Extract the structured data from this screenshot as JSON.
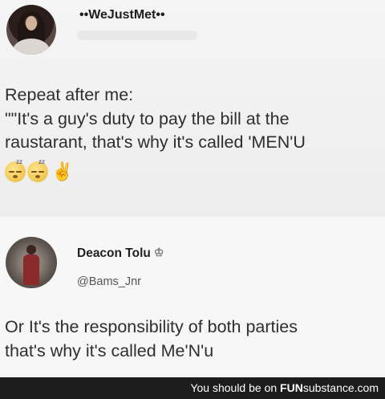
{
  "tweet1": {
    "handle": "••WeJustMet••",
    "lines": [
      "Repeat after me:",
      "\"\"It's a guy's duty to pay the bill at the",
      "raustarant, that's why it's called 'MEN'U"
    ],
    "emojis": [
      "sleeping-face-icon",
      "sleeping-face-icon",
      "victory-hand-icon"
    ]
  },
  "tweet2": {
    "name": "Deacon Tolu",
    "name_icon": "crown-icon",
    "handle": "@Bams_Jnr",
    "lines": [
      "Or It's the responsibility of both parties",
      "that's why it's called Me'N'u"
    ]
  },
  "footer": {
    "prefix": "You should be on ",
    "brand_bold": "FUN",
    "brand_rest": "substance.com"
  },
  "colors": {
    "background": "#f3f3f3",
    "footer_background": "#1d1d1d",
    "footer_text": "#ffffff",
    "text": "#2e2e2e"
  }
}
